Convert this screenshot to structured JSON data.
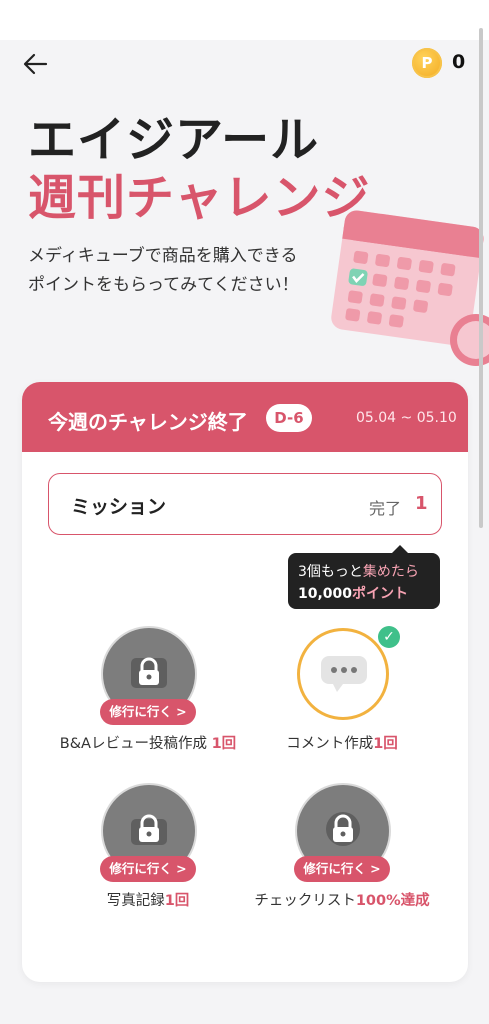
{
  "header": {
    "back_icon": "arrow-left-icon",
    "coin_icon": "coin-icon",
    "coin_glyph": "P",
    "points": "0"
  },
  "hero": {
    "title_line1": "エイジアール",
    "title_line2": "週刊チャレンジ",
    "description_line1": "メディキューブで商品を購入できる",
    "description_line2": "ポイントをもらってみてください！"
  },
  "challenge": {
    "title": "今週のチャレンジ終了",
    "dday": "D-6",
    "date_range": "05.04 ~ 05.10"
  },
  "mission_box": {
    "label": "ミッション",
    "complete_label": "完了",
    "complete_count": "1"
  },
  "tooltip": {
    "line1_prefix": "3個もっと",
    "line1_highlight": "集めたら",
    "line2_prefix": "10,000",
    "line2_highlight": "ポイント"
  },
  "missions": [
    {
      "name": "B&Aレビュー投稿作成",
      "count": "1回",
      "status": "locked",
      "button": "修行に行く >"
    },
    {
      "name": "コメント作成",
      "count": "1回",
      "status": "done",
      "button": ""
    },
    {
      "name": "写真記録",
      "count": "1回",
      "status": "locked",
      "button": "修行に行く >"
    },
    {
      "name": "チェックリスト",
      "count": "100%達成",
      "status": "locked",
      "button": "修行に行く >"
    }
  ],
  "colors": {
    "accent": "#d8556b",
    "text": "#222222",
    "gold": "#f2b23f",
    "check": "#3fc08a"
  }
}
